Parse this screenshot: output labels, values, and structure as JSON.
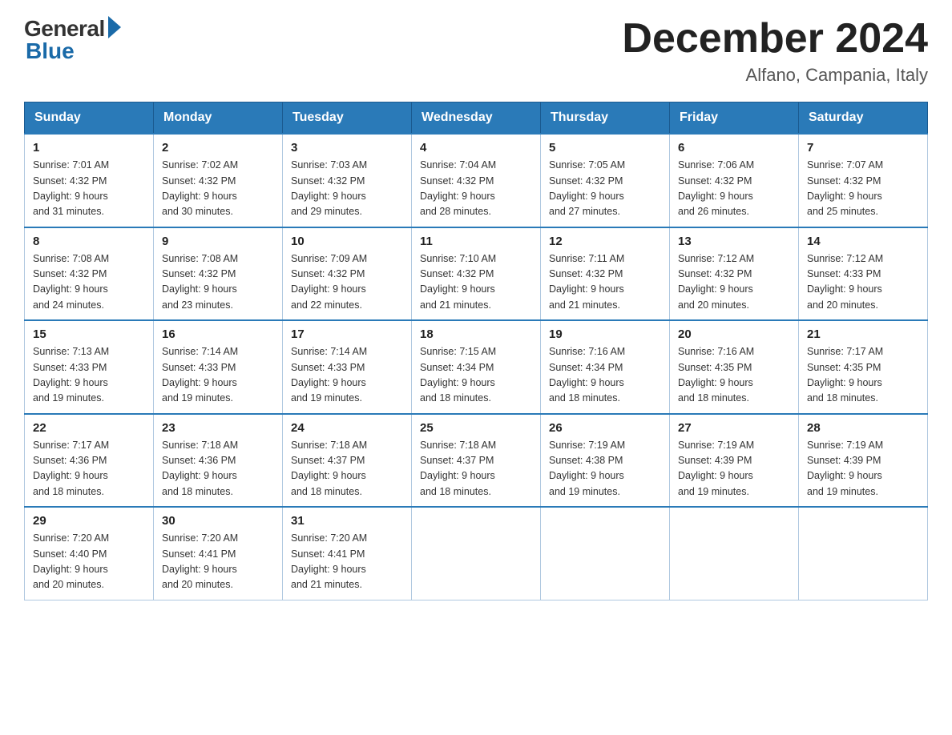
{
  "logo": {
    "general": "General",
    "blue": "Blue"
  },
  "title": "December 2024",
  "location": "Alfano, Campania, Italy",
  "days_of_week": [
    "Sunday",
    "Monday",
    "Tuesday",
    "Wednesday",
    "Thursday",
    "Friday",
    "Saturday"
  ],
  "weeks": [
    [
      {
        "day": "1",
        "sunrise": "7:01 AM",
        "sunset": "4:32 PM",
        "daylight": "9 hours and 31 minutes."
      },
      {
        "day": "2",
        "sunrise": "7:02 AM",
        "sunset": "4:32 PM",
        "daylight": "9 hours and 30 minutes."
      },
      {
        "day": "3",
        "sunrise": "7:03 AM",
        "sunset": "4:32 PM",
        "daylight": "9 hours and 29 minutes."
      },
      {
        "day": "4",
        "sunrise": "7:04 AM",
        "sunset": "4:32 PM",
        "daylight": "9 hours and 28 minutes."
      },
      {
        "day": "5",
        "sunrise": "7:05 AM",
        "sunset": "4:32 PM",
        "daylight": "9 hours and 27 minutes."
      },
      {
        "day": "6",
        "sunrise": "7:06 AM",
        "sunset": "4:32 PM",
        "daylight": "9 hours and 26 minutes."
      },
      {
        "day": "7",
        "sunrise": "7:07 AM",
        "sunset": "4:32 PM",
        "daylight": "9 hours and 25 minutes."
      }
    ],
    [
      {
        "day": "8",
        "sunrise": "7:08 AM",
        "sunset": "4:32 PM",
        "daylight": "9 hours and 24 minutes."
      },
      {
        "day": "9",
        "sunrise": "7:08 AM",
        "sunset": "4:32 PM",
        "daylight": "9 hours and 23 minutes."
      },
      {
        "day": "10",
        "sunrise": "7:09 AM",
        "sunset": "4:32 PM",
        "daylight": "9 hours and 22 minutes."
      },
      {
        "day": "11",
        "sunrise": "7:10 AM",
        "sunset": "4:32 PM",
        "daylight": "9 hours and 21 minutes."
      },
      {
        "day": "12",
        "sunrise": "7:11 AM",
        "sunset": "4:32 PM",
        "daylight": "9 hours and 21 minutes."
      },
      {
        "day": "13",
        "sunrise": "7:12 AM",
        "sunset": "4:32 PM",
        "daylight": "9 hours and 20 minutes."
      },
      {
        "day": "14",
        "sunrise": "7:12 AM",
        "sunset": "4:33 PM",
        "daylight": "9 hours and 20 minutes."
      }
    ],
    [
      {
        "day": "15",
        "sunrise": "7:13 AM",
        "sunset": "4:33 PM",
        "daylight": "9 hours and 19 minutes."
      },
      {
        "day": "16",
        "sunrise": "7:14 AM",
        "sunset": "4:33 PM",
        "daylight": "9 hours and 19 minutes."
      },
      {
        "day": "17",
        "sunrise": "7:14 AM",
        "sunset": "4:33 PM",
        "daylight": "9 hours and 19 minutes."
      },
      {
        "day": "18",
        "sunrise": "7:15 AM",
        "sunset": "4:34 PM",
        "daylight": "9 hours and 18 minutes."
      },
      {
        "day": "19",
        "sunrise": "7:16 AM",
        "sunset": "4:34 PM",
        "daylight": "9 hours and 18 minutes."
      },
      {
        "day": "20",
        "sunrise": "7:16 AM",
        "sunset": "4:35 PM",
        "daylight": "9 hours and 18 minutes."
      },
      {
        "day": "21",
        "sunrise": "7:17 AM",
        "sunset": "4:35 PM",
        "daylight": "9 hours and 18 minutes."
      }
    ],
    [
      {
        "day": "22",
        "sunrise": "7:17 AM",
        "sunset": "4:36 PM",
        "daylight": "9 hours and 18 minutes."
      },
      {
        "day": "23",
        "sunrise": "7:18 AM",
        "sunset": "4:36 PM",
        "daylight": "9 hours and 18 minutes."
      },
      {
        "day": "24",
        "sunrise": "7:18 AM",
        "sunset": "4:37 PM",
        "daylight": "9 hours and 18 minutes."
      },
      {
        "day": "25",
        "sunrise": "7:18 AM",
        "sunset": "4:37 PM",
        "daylight": "9 hours and 18 minutes."
      },
      {
        "day": "26",
        "sunrise": "7:19 AM",
        "sunset": "4:38 PM",
        "daylight": "9 hours and 19 minutes."
      },
      {
        "day": "27",
        "sunrise": "7:19 AM",
        "sunset": "4:39 PM",
        "daylight": "9 hours and 19 minutes."
      },
      {
        "day": "28",
        "sunrise": "7:19 AM",
        "sunset": "4:39 PM",
        "daylight": "9 hours and 19 minutes."
      }
    ],
    [
      {
        "day": "29",
        "sunrise": "7:20 AM",
        "sunset": "4:40 PM",
        "daylight": "9 hours and 20 minutes."
      },
      {
        "day": "30",
        "sunrise": "7:20 AM",
        "sunset": "4:41 PM",
        "daylight": "9 hours and 20 minutes."
      },
      {
        "day": "31",
        "sunrise": "7:20 AM",
        "sunset": "4:41 PM",
        "daylight": "9 hours and 21 minutes."
      },
      null,
      null,
      null,
      null
    ]
  ],
  "labels": {
    "sunrise": "Sunrise:",
    "sunset": "Sunset:",
    "daylight": "Daylight:"
  }
}
